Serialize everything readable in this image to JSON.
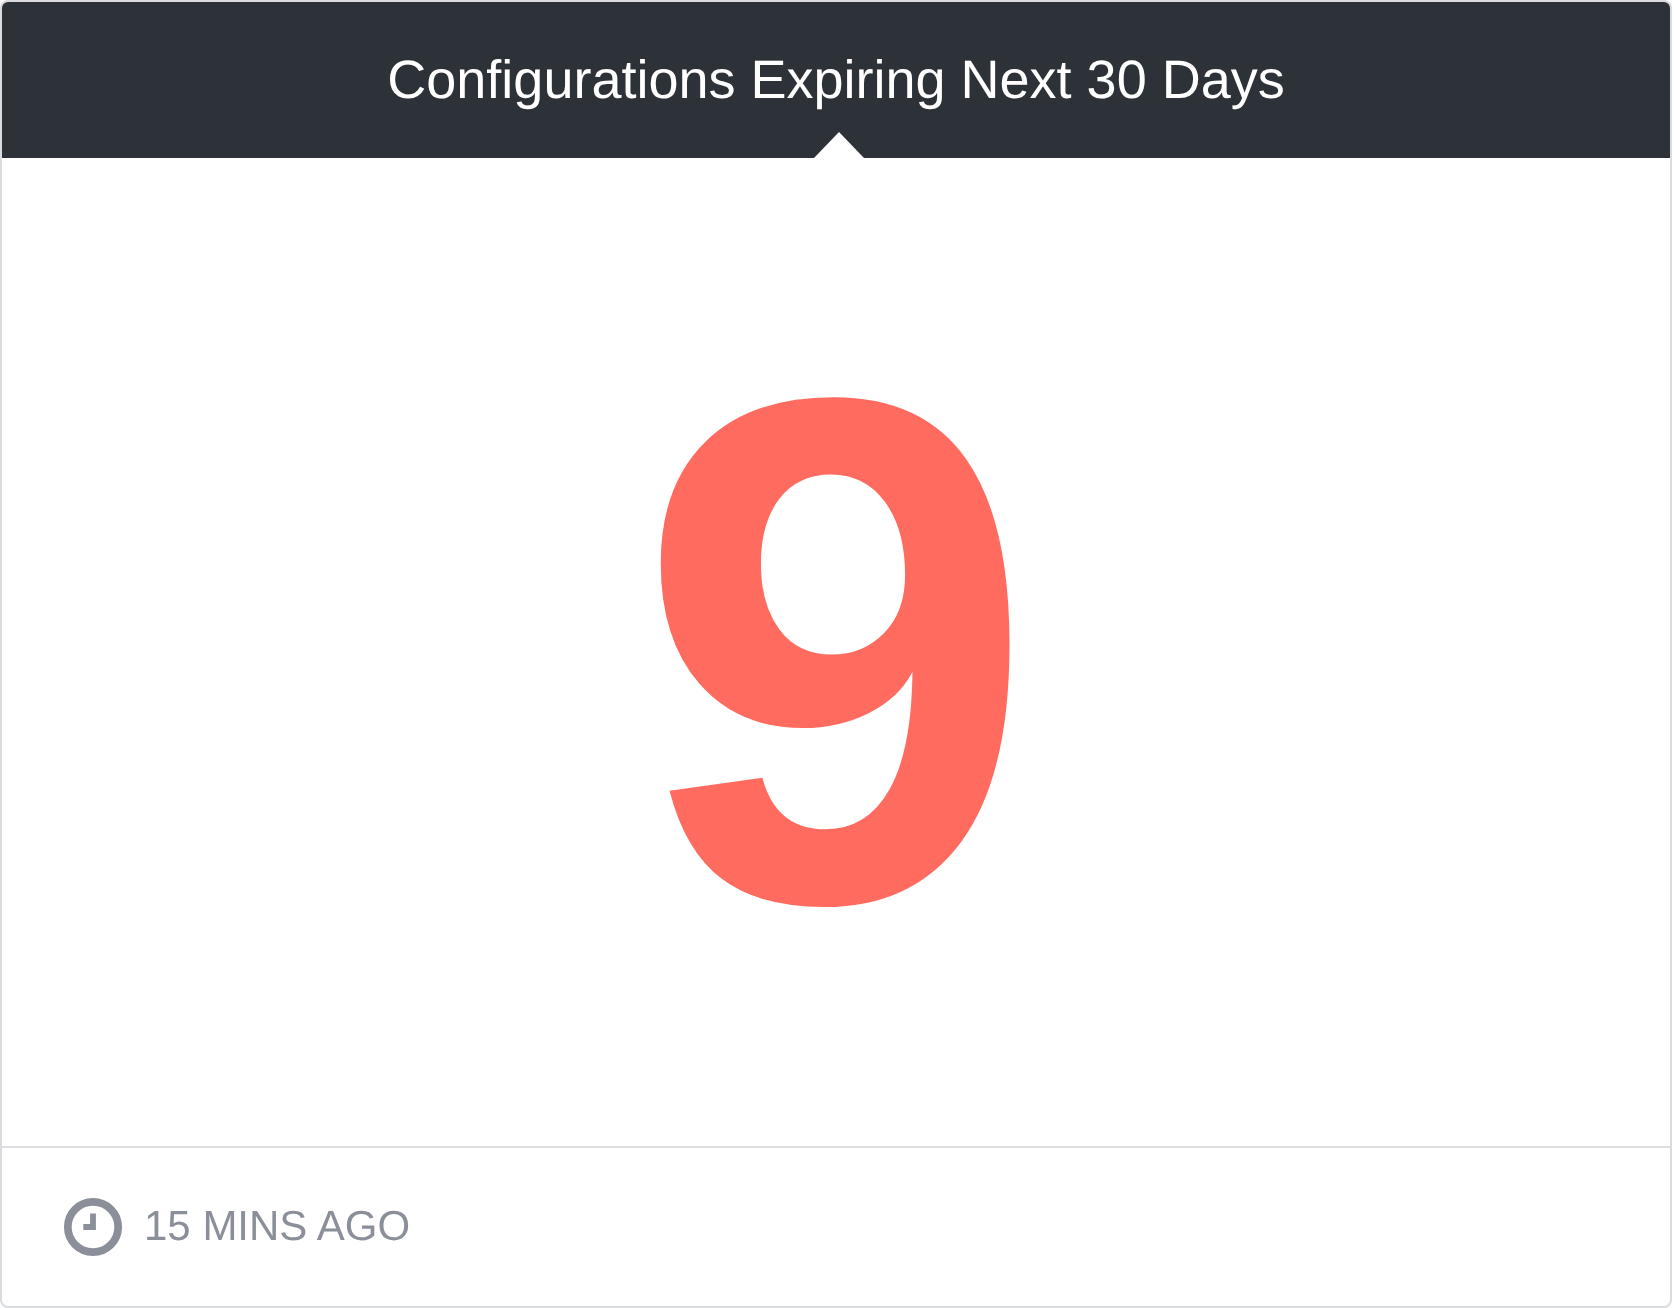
{
  "header": {
    "title": "Configurations Expiring Next 30 Days"
  },
  "metric": {
    "value": "9"
  },
  "footer": {
    "updated": "15 MINS AGO"
  }
}
